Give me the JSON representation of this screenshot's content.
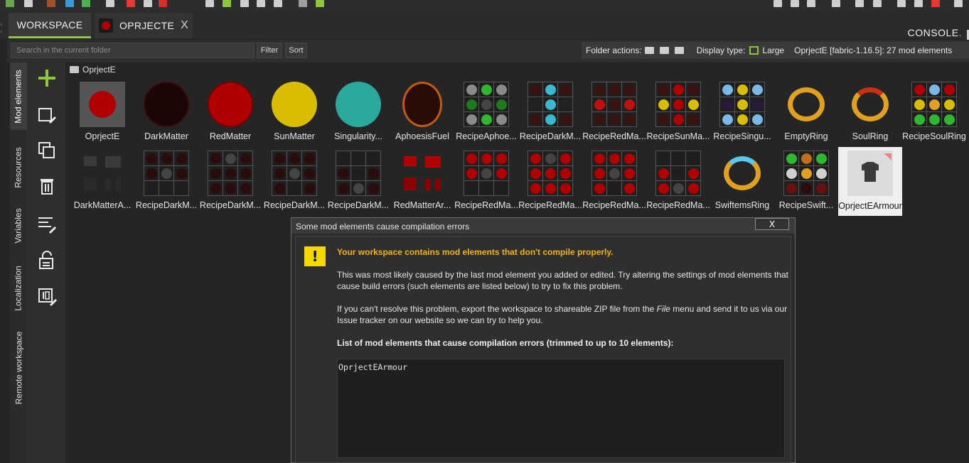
{
  "tabs": {
    "workspace": "WORKSPACE",
    "project": "OPRJECTE",
    "project_close": "X",
    "console": "CONSOLE",
    "console_dot": "."
  },
  "search": {
    "placeholder": "Search in the current folder",
    "filter": "Filter",
    "sort": "Sort"
  },
  "folderbar": {
    "folder_actions": "Folder actions:",
    "display_type": "Display type:",
    "display_value": "Large",
    "workspace_info": "OprjectE [fabric-1.16.5]: 27 mod elements"
  },
  "vtabs": {
    "mod": "Mod elements",
    "resources": "Resources",
    "variables": "Variables",
    "localization": "Localization",
    "remote": "Remote workspace"
  },
  "breadcrumb": "OprjectE",
  "elements": [
    {
      "label": "OprjectE"
    },
    {
      "label": "DarkMatter"
    },
    {
      "label": "RedMatter"
    },
    {
      "label": "SunMatter"
    },
    {
      "label": "Singularity..."
    },
    {
      "label": "AphoesisFuel"
    },
    {
      "label": "RecipeAphoe..."
    },
    {
      "label": "RecipeDarkM..."
    },
    {
      "label": "RecipeRedMa..."
    },
    {
      "label": "RecipeSunMa..."
    },
    {
      "label": "RecipeSingu..."
    },
    {
      "label": "EmptyRing"
    },
    {
      "label": "SoulRing"
    },
    {
      "label": "RecipeSoulRing"
    },
    {
      "label": "DarkMatterA..."
    },
    {
      "label": "RecipeDarkM..."
    },
    {
      "label": "RecipeDarkM..."
    },
    {
      "label": "RecipeDarkM..."
    },
    {
      "label": "RecipeDarkM..."
    },
    {
      "label": "RedMatterAr..."
    },
    {
      "label": "RecipeRedMa..."
    },
    {
      "label": "RecipeRedMa..."
    },
    {
      "label": "RecipeRedMa..."
    },
    {
      "label": "RecipeRedMa..."
    },
    {
      "label": "SwiftemsRing"
    },
    {
      "label": "RecipeSwift..."
    },
    {
      "label": "OprjectEArmour"
    }
  ],
  "colors": {
    "accent": "#8ec63f",
    "warning": "#f0b400",
    "dark_matter": "#1b0606",
    "red_matter": "#b10000",
    "sun_matter": "#d8bd00",
    "singularity": "#2aa89a",
    "ring_gold": "#e0a020"
  },
  "dialog": {
    "title": "Some mod elements cause compilation errors",
    "close": "X",
    "heading": "Your workspace contains mod elements that don't compile properly.",
    "p1": "This was most likely caused by the last mod element you added or edited. Try altering the settings of mod elements that cause build errors (such elements are listed below) to try to fix this problem.",
    "p2_before": "If you can't resolve this problem, export the workspace to shareable ZIP file from the ",
    "p2_menu": "File",
    "p2_after": " menu and send it to us via our Issue tracker on our website so we can try to help you.",
    "list_title": "List of mod elements that cause compilation errors (trimmed to up to 10 elements):",
    "list_items": "OprjectEArmour"
  }
}
